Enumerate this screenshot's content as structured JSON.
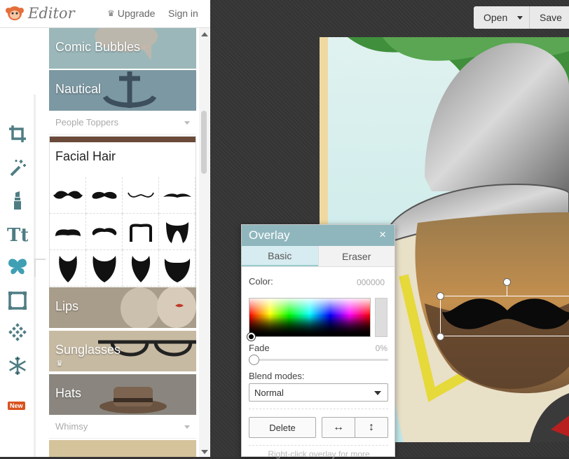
{
  "topbar": {
    "app_name": "Editor",
    "upgrade_label": "Upgrade",
    "signin_label": "Sign in"
  },
  "toolbar": {
    "tools": [
      "crop-icon",
      "magic-wand-icon",
      "lipstick-icon",
      "text-icon",
      "butterfly-icon",
      "frame-icon",
      "texture-icon",
      "snowflake-icon"
    ],
    "new_badge": "New"
  },
  "panel": {
    "categories_top": [
      "Comic Bubbles",
      "Nautical"
    ],
    "section1": "People Toppers",
    "facial_hair": {
      "title": "Facial Hair",
      "item_count": 12
    },
    "categories_bottom": [
      "Lips",
      "Sunglasses",
      "Hats"
    ],
    "section2": "Whimsy"
  },
  "file_menu": {
    "open_label": "Open",
    "save_label": "Save"
  },
  "overlay_dialog": {
    "title": "Overlay",
    "close_glyph": "×",
    "tabs": [
      "Basic",
      "Eraser"
    ],
    "color_label": "Color:",
    "color_value": "000000",
    "fade_label": "Fade",
    "fade_value": "0%",
    "fade_level": 0,
    "blend_label": "Blend modes:",
    "blend_value": "Normal",
    "delete_label": "Delete",
    "flip_h_glyph": "↔",
    "flip_v_glyph": "↕",
    "hint": "Right-click overlay for more"
  },
  "colors": {
    "accent": "#8fb6bd",
    "new_badge": "#d9531e"
  }
}
